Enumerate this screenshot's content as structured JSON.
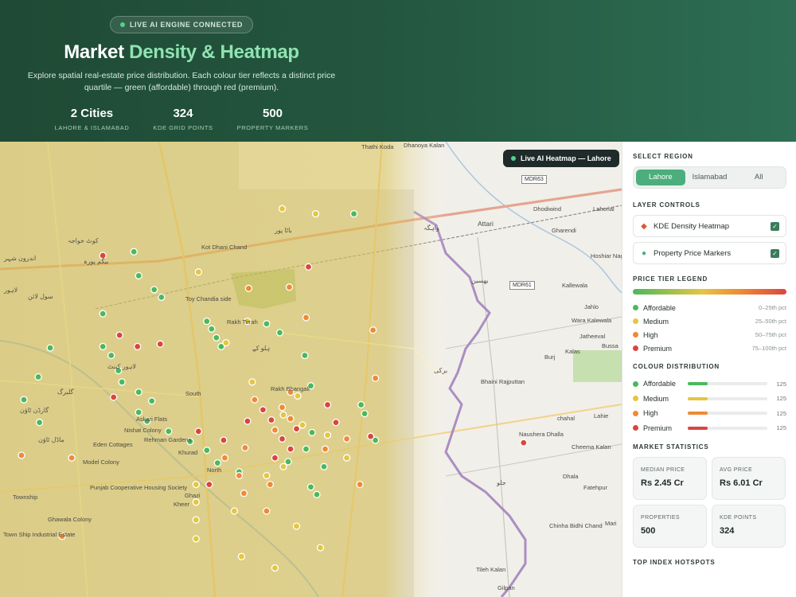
{
  "hero": {
    "badge": "LIVE AI ENGINE CONNECTED",
    "title_main": "Market",
    "title_accent": "Density & Heatmap",
    "subtitle": "Explore spatial real-estate price distribution. Each colour tier reflects a distinct price quartile — green (affordable) through red (premium).",
    "stats": [
      {
        "value": "2 Cities",
        "label": "LAHORE & ISLAMABAD"
      },
      {
        "value": "324",
        "label": "KDE GRID POINTS"
      },
      {
        "value": "500",
        "label": "PROPERTY MARKERS"
      }
    ]
  },
  "map": {
    "live_badge": "Live AI Heatmap — Lahore",
    "places": [
      "Thathi Koda",
      "Dhanoya Kalan",
      "Attari",
      "Dhodiwind",
      "Lahorial",
      "Gharendi",
      "Hoshiar Nagar",
      "Kallewala",
      "Jahlo",
      "Wara Kalewala",
      "Jatheeval",
      "Kalas",
      "Bussa",
      "Burj",
      "Bhaini Rajputtan",
      "chahal",
      "Lahie",
      "Naushera Dhalla",
      "Cheema Kalan",
      "Dhala",
      "Fatehpur",
      "Mari",
      "Chinha Bidhi Chand",
      "Tileh Kalan",
      "Gilpan",
      "Rakh Bhangali",
      "Askari Flats",
      "Nishat Colony",
      "Eden Cottages",
      "Rehman Gardens",
      "Model Colony",
      "Punjab Cooperative Housing Society",
      "Township",
      "Ghawala Colony",
      "Town Ship Industrial Estate",
      "Kot Dhani Chand",
      "Toy Chandia side",
      "Rakh Tirrah",
      "South",
      "Kheer",
      "North",
      "Khurad",
      "Ghazi"
    ],
    "urdu": [
      "لاہور",
      "سول لائن",
      "کوٹ خواجہ",
      "اندرون شہر",
      "بیگم پورہ",
      "لاہور کینٹ",
      "ماڈل ٹاؤن",
      "گارڈن ٹاؤن",
      "گلبرگ",
      "باٹا پور",
      "ہلو کے",
      "واہگہ",
      "بھسین",
      "برکی",
      "جلو"
    ],
    "road_tags": [
      "MDR63",
      "MDR61"
    ],
    "markers": [
      {
        "tier": "affordable",
        "lat": 31.603,
        "lon": 74.382
      },
      {
        "tier": "affordable",
        "lat": 31.584,
        "lon": 74.386
      },
      {
        "tier": "affordable",
        "lat": 31.573,
        "lon": 74.399
      },
      {
        "tier": "affordable",
        "lat": 31.567,
        "lon": 74.405
      },
      {
        "tier": "affordable",
        "lat": 31.548,
        "lon": 74.443
      },
      {
        "tier": "affordable",
        "lat": 31.542,
        "lon": 74.447
      },
      {
        "tier": "affordable",
        "lat": 31.535,
        "lon": 74.451
      },
      {
        "tier": "affordable",
        "lat": 31.528,
        "lon": 74.455
      },
      {
        "tier": "affordable",
        "lat": 31.554,
        "lon": 74.356
      },
      {
        "tier": "affordable",
        "lat": 31.528,
        "lon": 74.356
      },
      {
        "tier": "affordable",
        "lat": 31.521,
        "lon": 74.363
      },
      {
        "tier": "affordable",
        "lat": 31.509,
        "lon": 74.369
      },
      {
        "tier": "affordable",
        "lat": 31.5,
        "lon": 74.372
      },
      {
        "tier": "affordable",
        "lat": 31.492,
        "lon": 74.386
      },
      {
        "tier": "affordable",
        "lat": 31.485,
        "lon": 74.397
      },
      {
        "tier": "affordable",
        "lat": 31.476,
        "lon": 74.386
      },
      {
        "tier": "affordable",
        "lat": 31.469,
        "lon": 74.393
      },
      {
        "tier": "affordable",
        "lat": 31.461,
        "lon": 74.411
      },
      {
        "tier": "affordable",
        "lat": 31.453,
        "lon": 74.429
      },
      {
        "tier": "affordable",
        "lat": 31.446,
        "lon": 74.443
      },
      {
        "tier": "affordable",
        "lat": 31.436,
        "lon": 74.452
      },
      {
        "tier": "affordable",
        "lat": 31.429,
        "lon": 74.47
      },
      {
        "tier": "affordable",
        "lat": 31.546,
        "lon": 74.493
      },
      {
        "tier": "affordable",
        "lat": 31.539,
        "lon": 74.504
      },
      {
        "tier": "affordable",
        "lat": 31.497,
        "lon": 74.53
      },
      {
        "tier": "affordable",
        "lat": 31.521,
        "lon": 74.525
      },
      {
        "tier": "affordable",
        "lat": 31.46,
        "lon": 74.531
      },
      {
        "tier": "affordable",
        "lat": 31.447,
        "lon": 74.526
      },
      {
        "tier": "affordable",
        "lat": 31.433,
        "lon": 74.541
      },
      {
        "tier": "affordable",
        "lat": 31.437,
        "lon": 74.511
      },
      {
        "tier": "affordable",
        "lat": 31.417,
        "lon": 74.53
      },
      {
        "tier": "affordable",
        "lat": 31.411,
        "lon": 74.535
      },
      {
        "tier": "affordable",
        "lat": 31.482,
        "lon": 74.572
      },
      {
        "tier": "affordable",
        "lat": 31.475,
        "lon": 74.575
      },
      {
        "tier": "affordable",
        "lat": 31.454,
        "lon": 74.584
      },
      {
        "tier": "affordable",
        "lat": 31.633,
        "lon": 74.566
      },
      {
        "tier": "affordable",
        "lat": 31.504,
        "lon": 74.302
      },
      {
        "tier": "affordable",
        "lat": 31.527,
        "lon": 74.312
      },
      {
        "tier": "affordable",
        "lat": 31.468,
        "lon": 74.303
      },
      {
        "tier": "affordable",
        "lat": 31.486,
        "lon": 74.29
      },
      {
        "tier": "medium",
        "lat": 31.637,
        "lon": 74.506
      },
      {
        "tier": "medium",
        "lat": 31.633,
        "lon": 74.534
      },
      {
        "tier": "medium",
        "lat": 31.587,
        "lon": 74.436
      },
      {
        "tier": "medium",
        "lat": 31.548,
        "lon": 74.477
      },
      {
        "tier": "medium",
        "lat": 31.531,
        "lon": 74.459
      },
      {
        "tier": "medium",
        "lat": 31.5,
        "lon": 74.481
      },
      {
        "tier": "medium",
        "lat": 31.489,
        "lon": 74.519
      },
      {
        "tier": "medium",
        "lat": 31.474,
        "lon": 74.507
      },
      {
        "tier": "medium",
        "lat": 31.466,
        "lon": 74.523
      },
      {
        "tier": "medium",
        "lat": 31.458,
        "lon": 74.544
      },
      {
        "tier": "medium",
        "lat": 31.44,
        "lon": 74.56
      },
      {
        "tier": "medium",
        "lat": 31.433,
        "lon": 74.507
      },
      {
        "tier": "medium",
        "lat": 31.426,
        "lon": 74.493
      },
      {
        "tier": "medium",
        "lat": 31.419,
        "lon": 74.434
      },
      {
        "tier": "medium",
        "lat": 31.405,
        "lon": 74.434
      },
      {
        "tier": "medium",
        "lat": 31.398,
        "lon": 74.466
      },
      {
        "tier": "medium",
        "lat": 31.391,
        "lon": 74.434
      },
      {
        "tier": "medium",
        "lat": 31.386,
        "lon": 74.518
      },
      {
        "tier": "medium",
        "lat": 31.376,
        "lon": 74.434
      },
      {
        "tier": "medium",
        "lat": 31.369,
        "lon": 74.538
      },
      {
        "tier": "medium",
        "lat": 31.362,
        "lon": 74.472
      },
      {
        "tier": "medium",
        "lat": 31.353,
        "lon": 74.5
      },
      {
        "tier": "high",
        "lat": 31.574,
        "lon": 74.478
      },
      {
        "tier": "high",
        "lat": 31.575,
        "lon": 74.512
      },
      {
        "tier": "high",
        "lat": 31.551,
        "lon": 74.526
      },
      {
        "tier": "high",
        "lat": 31.541,
        "lon": 74.582
      },
      {
        "tier": "high",
        "lat": 31.503,
        "lon": 74.584
      },
      {
        "tier": "high",
        "lat": 31.486,
        "lon": 74.483
      },
      {
        "tier": "high",
        "lat": 31.492,
        "lon": 74.513
      },
      {
        "tier": "high",
        "lat": 31.48,
        "lon": 74.506
      },
      {
        "tier": "high",
        "lat": 31.471,
        "lon": 74.513
      },
      {
        "tier": "high",
        "lat": 31.462,
        "lon": 74.5
      },
      {
        "tier": "high",
        "lat": 31.448,
        "lon": 74.475
      },
      {
        "tier": "high",
        "lat": 31.44,
        "lon": 74.458
      },
      {
        "tier": "high",
        "lat": 31.426,
        "lon": 74.47
      },
      {
        "tier": "high",
        "lat": 31.419,
        "lon": 74.496
      },
      {
        "tier": "high",
        "lat": 31.412,
        "lon": 74.474
      },
      {
        "tier": "high",
        "lat": 31.398,
        "lon": 74.493
      },
      {
        "tier": "high",
        "lat": 31.455,
        "lon": 74.56
      },
      {
        "tier": "high",
        "lat": 31.447,
        "lon": 74.542
      },
      {
        "tier": "high",
        "lat": 31.419,
        "lon": 74.571
      },
      {
        "tier": "high",
        "lat": 31.44,
        "lon": 74.33
      },
      {
        "tier": "high",
        "lat": 31.442,
        "lon": 74.288
      },
      {
        "tier": "high",
        "lat": 31.378,
        "lon": 74.322
      },
      {
        "tier": "premium",
        "lat": 31.591,
        "lon": 74.528
      },
      {
        "tier": "premium",
        "lat": 31.6,
        "lon": 74.356
      },
      {
        "tier": "premium",
        "lat": 31.537,
        "lon": 74.37
      },
      {
        "tier": "premium",
        "lat": 31.528,
        "lon": 74.385
      },
      {
        "tier": "premium",
        "lat": 31.488,
        "lon": 74.365
      },
      {
        "tier": "premium",
        "lat": 31.461,
        "lon": 74.436
      },
      {
        "tier": "premium",
        "lat": 31.454,
        "lon": 74.457
      },
      {
        "tier": "premium",
        "lat": 31.469,
        "lon": 74.477
      },
      {
        "tier": "premium",
        "lat": 31.478,
        "lon": 74.49
      },
      {
        "tier": "premium",
        "lat": 31.47,
        "lon": 74.497
      },
      {
        "tier": "premium",
        "lat": 31.463,
        "lon": 74.518
      },
      {
        "tier": "premium",
        "lat": 31.455,
        "lon": 74.506
      },
      {
        "tier": "premium",
        "lat": 31.447,
        "lon": 74.513
      },
      {
        "tier": "premium",
        "lat": 31.44,
        "lon": 74.5
      },
      {
        "tier": "premium",
        "lat": 31.482,
        "lon": 74.544
      },
      {
        "tier": "premium",
        "lat": 31.468,
        "lon": 74.551
      },
      {
        "tier": "premium",
        "lat": 31.457,
        "lon": 74.58
      },
      {
        "tier": "premium",
        "lat": 31.419,
        "lon": 74.445
      },
      {
        "tier": "premium",
        "lat": 31.53,
        "lon": 74.404
      },
      {
        "tier": "premium",
        "lat": 31.452,
        "lon": 74.708
      }
    ]
  },
  "panel": {
    "region_title": "SELECT REGION",
    "regions": [
      "Lahore",
      "Islamabad",
      "All"
    ],
    "layer_title": "LAYER CONTROLS",
    "layers": [
      {
        "label": "KDE Density Heatmap",
        "icon": "flame-icon"
      },
      {
        "label": "Property Price Markers",
        "icon": "pin-icon"
      }
    ],
    "legend_title": "PRICE TIER LEGEND",
    "tiers": [
      {
        "name": "Affordable",
        "range": "0–25th pct",
        "color": "#4cb85c"
      },
      {
        "name": "Medium",
        "range": "25–50th pct",
        "color": "#e4c640"
      },
      {
        "name": "High",
        "range": "50–75th pct",
        "color": "#ef8a35"
      },
      {
        "name": "Premium",
        "range": "75–100th pct",
        "color": "#d9463f"
      }
    ],
    "dist_title": "COLOUR DISTRIBUTION",
    "distribution": [
      {
        "name": "Affordable",
        "count": "125",
        "fraction": 0.25
      },
      {
        "name": "Medium",
        "count": "125",
        "fraction": 0.25
      },
      {
        "name": "High",
        "count": "125",
        "fraction": 0.25
      },
      {
        "name": "Premium",
        "count": "125",
        "fraction": 0.25
      }
    ],
    "stats_title": "MARKET STATISTICS",
    "stats": [
      {
        "label": "MEDIAN PRICE",
        "value": "Rs 2.45 Cr"
      },
      {
        "label": "AVG PRICE",
        "value": "Rs 6.01 Cr"
      },
      {
        "label": "PROPERTIES",
        "value": "500"
      },
      {
        "label": "KDE POINTS",
        "value": "324"
      }
    ],
    "hotspots_title": "TOP INDEX HOTSPOTS"
  }
}
